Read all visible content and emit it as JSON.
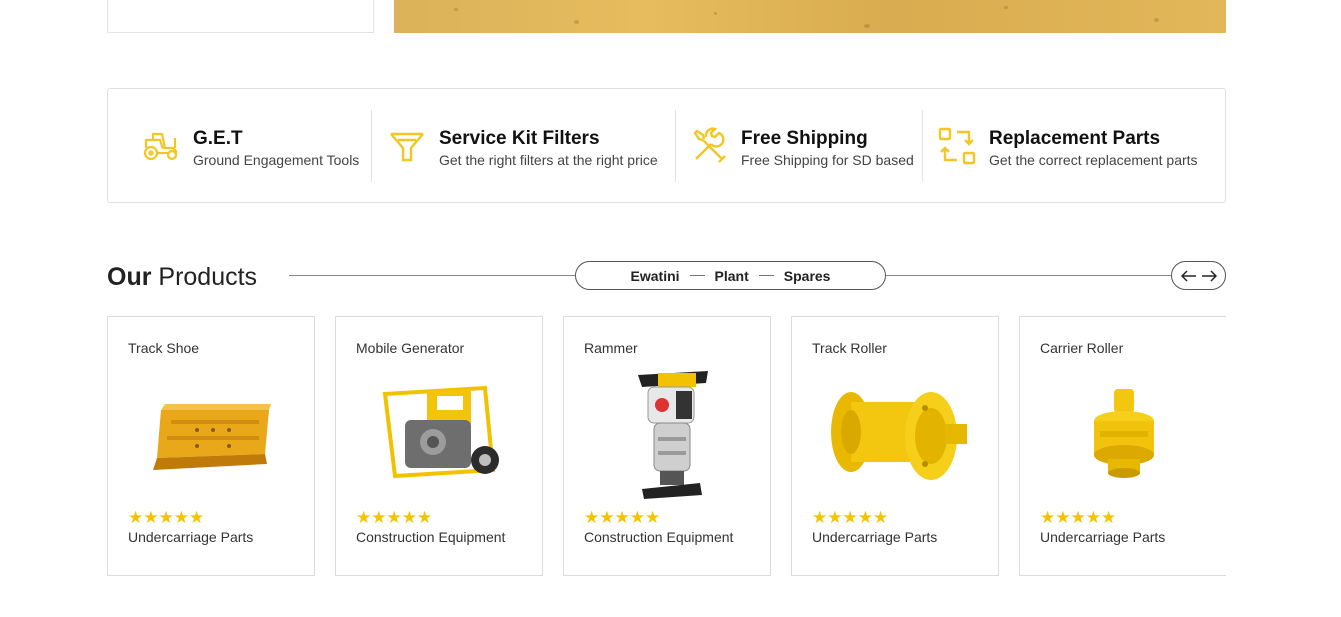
{
  "colors": {
    "accent": "#f5c400",
    "icon_yellow": "#f3c623"
  },
  "features": [
    {
      "icon": "tractor-icon",
      "title": "G.E.T",
      "subtitle": "Ground Engagement Tools"
    },
    {
      "icon": "filter-funnel-icon",
      "title": "Service Kit Filters",
      "subtitle": "Get the right filters at the right price"
    },
    {
      "icon": "wrench-screwdriver-icon",
      "title": "Free Shipping",
      "subtitle": "Free Shipping for SD based"
    },
    {
      "icon": "replacement-swap-icon",
      "title": "Replacement Parts",
      "subtitle": "Get the correct replacement parts"
    }
  ],
  "products_section": {
    "title_bold": "Our",
    "title_rest": " Products",
    "pill": [
      "Ewatini",
      "Plant",
      "Spares"
    ],
    "prev_icon": "arrow-left-icon",
    "next_icon": "arrow-right-icon"
  },
  "products": [
    {
      "name": "Track Shoe",
      "image": "track-shoe-image",
      "stars": "★★★★★",
      "rating": 5,
      "category": "Undercarriage Parts"
    },
    {
      "name": "Mobile Generator",
      "image": "mobile-generator-image",
      "stars": "★★★★★",
      "rating": 5,
      "category": "Construction Equipment"
    },
    {
      "name": "Rammer",
      "image": "rammer-image",
      "stars": "★★★★★",
      "rating": 5,
      "category": "Construction Equipment"
    },
    {
      "name": "Track Roller",
      "image": "track-roller-image",
      "stars": "★★★★★",
      "rating": 5,
      "category": "Undercarriage Parts"
    },
    {
      "name": "Carrier Roller",
      "image": "carrier-roller-image",
      "stars": "★★★★★",
      "rating": 5,
      "category": "Undercarriage Parts"
    }
  ]
}
